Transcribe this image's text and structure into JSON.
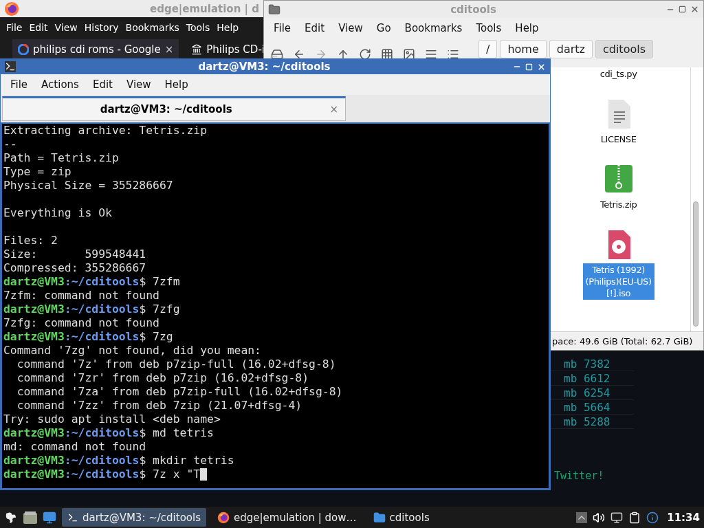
{
  "browser_window": {
    "title": "edge|emulation | d",
    "menu": [
      "File",
      "Edit",
      "View",
      "History",
      "Bookmarks",
      "Tools",
      "Help"
    ],
    "tabs": [
      {
        "title": "philips cdi roms - Google",
        "close": "×",
        "selected": true
      },
      {
        "title": "Philips CD-i",
        "selected": false
      }
    ]
  },
  "file_manager": {
    "title": "cditools",
    "menu": [
      "File",
      "Edit",
      "View",
      "Go",
      "Bookmarks",
      "Tools",
      "Help"
    ],
    "path": [
      {
        "label": "/",
        "selected": false
      },
      {
        "label": "home",
        "selected": false
      },
      {
        "label": "dartz",
        "selected": false
      },
      {
        "label": "cditools",
        "selected": true
      }
    ],
    "files": [
      {
        "name": "cdi_ts.py",
        "kind": "script",
        "selected": false
      },
      {
        "name": "LICENSE",
        "kind": "text",
        "selected": false
      },
      {
        "name": "Tetris.zip",
        "kind": "archive",
        "selected": false
      },
      {
        "name": "Tetris (1992) (Philips)(EU-US) [!].iso",
        "kind": "disc",
        "selected": true
      }
    ],
    "status": "pace: 49.6 GiB (Total: 62.7 GiB)"
  },
  "background_window": {
    "rows": [
      "mb 7382",
      "mb 6612",
      "mb 6254",
      "mb 5664",
      "mb 5288"
    ],
    "footer": "Twitter!"
  },
  "terminal_window": {
    "title": "dartz@VM3: ~/cditools",
    "menu": [
      "File",
      "Actions",
      "Edit",
      "View",
      "Help"
    ],
    "tab": {
      "title": "dartz@VM3: ~/cditools",
      "close": "×",
      "selected": true
    },
    "lines": [
      {
        "kind": "output",
        "text": "Extracting archive: Tetris.zip"
      },
      {
        "kind": "output",
        "text": "--"
      },
      {
        "kind": "output",
        "text": "Path = Tetris.zip"
      },
      {
        "kind": "output",
        "text": "Type = zip"
      },
      {
        "kind": "output",
        "text": "Physical Size = 355286667"
      },
      {
        "kind": "blank"
      },
      {
        "kind": "output",
        "text": "Everything is Ok"
      },
      {
        "kind": "blank"
      },
      {
        "kind": "output",
        "text": "Files: 2"
      },
      {
        "kind": "output",
        "text": "Size:       599548441"
      },
      {
        "kind": "output",
        "text": "Compressed: 355286667"
      },
      {
        "kind": "prompt",
        "user": "dartz@VM3",
        "path": ":~/cditools",
        "command": "$ 7zfm"
      },
      {
        "kind": "output",
        "text": "7zfm: command not found"
      },
      {
        "kind": "prompt",
        "user": "dartz@VM3",
        "path": ":~/cditools",
        "command": "$ 7zfg"
      },
      {
        "kind": "output",
        "text": "7zfg: command not found"
      },
      {
        "kind": "prompt",
        "user": "dartz@VM3",
        "path": ":~/cditools",
        "command": "$ 7zg"
      },
      {
        "kind": "output",
        "text": "Command '7zg' not found, did you mean:"
      },
      {
        "kind": "output",
        "text": "  command '7z' from deb p7zip-full (16.02+dfsg-8)"
      },
      {
        "kind": "output",
        "text": "  command '7zr' from deb p7zip (16.02+dfsg-8)"
      },
      {
        "kind": "output",
        "text": "  command '7za' from deb p7zip-full (16.02+dfsg-8)"
      },
      {
        "kind": "output",
        "text": "  command '7zz' from deb 7zip (21.07+dfsg-4)"
      },
      {
        "kind": "output",
        "text": "Try: sudo apt install <deb name>"
      },
      {
        "kind": "prompt",
        "user": "dartz@VM3",
        "path": ":~/cditools",
        "command": "$ md tetris"
      },
      {
        "kind": "output",
        "text": "md: command not found"
      },
      {
        "kind": "prompt",
        "user": "dartz@VM3",
        "path": ":~/cditools",
        "command": "$ mkdir tetris"
      },
      {
        "kind": "prompt",
        "user": "dartz@VM3",
        "path": ":~/cditools",
        "command": "$ 7z x \"T",
        "cursor": true
      }
    ]
  },
  "taskbar": {
    "tasks": [
      {
        "label": "dartz@VM3: ~/cditools",
        "kind": "terminal",
        "selected": true
      },
      {
        "label": "edge|emulation | dow…",
        "kind": "browser",
        "selected": false
      },
      {
        "label": "cditools",
        "kind": "folder",
        "selected": false
      }
    ],
    "clock": "11:34"
  }
}
